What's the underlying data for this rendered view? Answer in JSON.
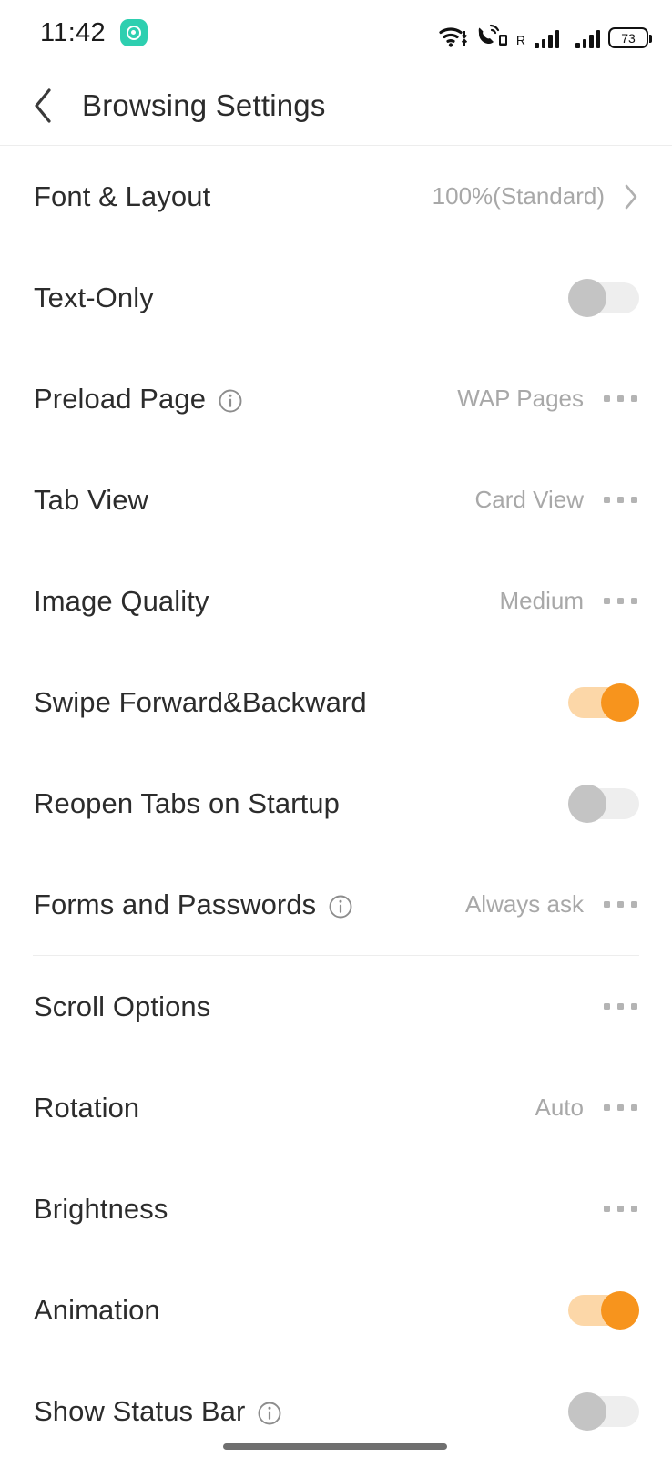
{
  "statusbar": {
    "time": "11:42",
    "app_icon": "messaging-app-icon",
    "icons": [
      "wifi-icon",
      "call-data-icon",
      "roaming-indicator",
      "signal-bars-sim1",
      "signal-bars-sim2",
      "battery-icon"
    ],
    "roaming_label": "R",
    "battery_level": "73"
  },
  "header": {
    "back_icon": "chevron-left-icon",
    "title": "Browsing Settings"
  },
  "settings": {
    "group_one": [
      {
        "label": "Font & Layout",
        "value": "100%(Standard)",
        "control": "chevron",
        "info": false
      },
      {
        "label": "Text-Only",
        "value": "",
        "control": "toggle-off",
        "info": false
      },
      {
        "label": "Preload Page",
        "value": "WAP Pages",
        "control": "dots",
        "info": true
      },
      {
        "label": "Tab View",
        "value": "Card View",
        "control": "dots",
        "info": false
      },
      {
        "label": "Image Quality",
        "value": "Medium",
        "control": "dots",
        "info": false
      },
      {
        "label": "Swipe Forward&Backward",
        "value": "",
        "control": "toggle-on",
        "info": false
      },
      {
        "label": "Reopen Tabs on Startup",
        "value": "",
        "control": "toggle-off",
        "info": false
      },
      {
        "label": "Forms and Passwords",
        "value": "Always ask",
        "control": "dots",
        "info": true
      }
    ],
    "group_two": [
      {
        "label": "Scroll Options",
        "value": "",
        "control": "dots",
        "info": false
      },
      {
        "label": "Rotation",
        "value": "Auto",
        "control": "dots",
        "info": false
      },
      {
        "label": "Brightness",
        "value": "",
        "control": "dots",
        "info": false
      },
      {
        "label": "Animation",
        "value": "",
        "control": "toggle-on",
        "info": false
      },
      {
        "label": "Show Status Bar",
        "value": "",
        "control": "toggle-off",
        "info": true
      }
    ]
  },
  "colors": {
    "accent": "#f7941d",
    "accent_track": "#fcd7a8",
    "toggle_off_knob": "#c4c4c4",
    "toggle_off_track": "#eeeeee",
    "value_text": "#a8a8a8",
    "label_text": "#2c2c2c",
    "divider": "#ededed",
    "app_icon": "#2ecfb0"
  }
}
